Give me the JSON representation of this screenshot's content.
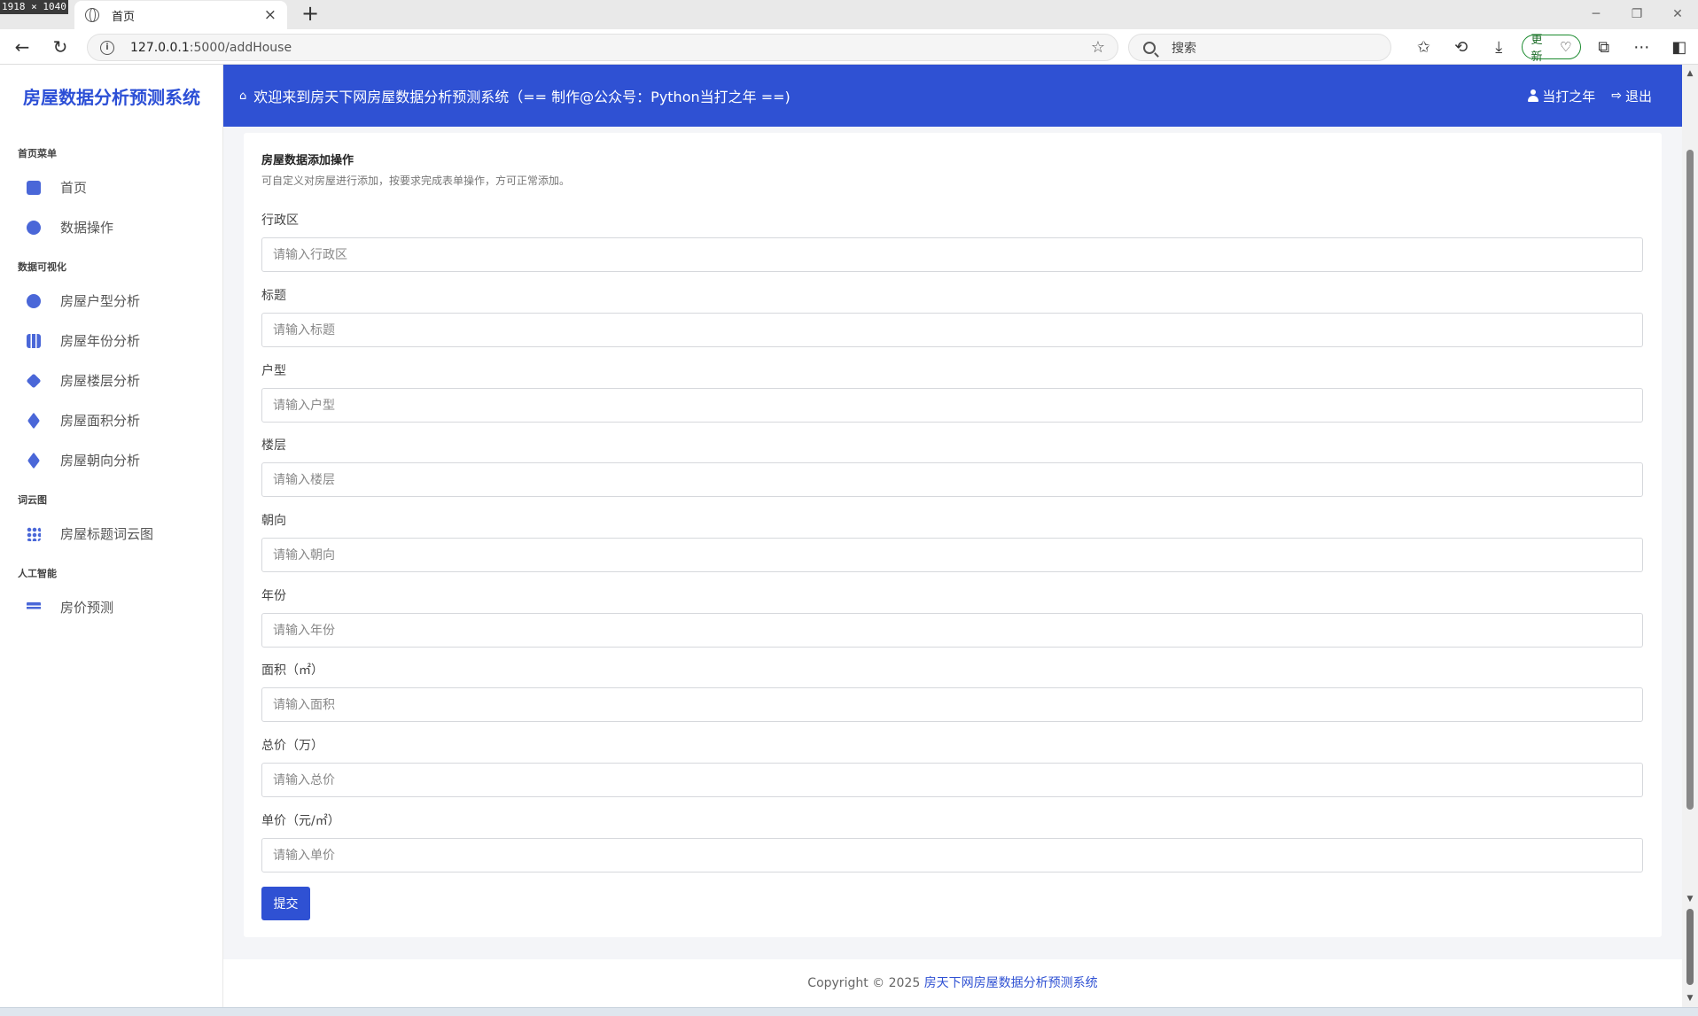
{
  "screen_badge": "1918 × 1040",
  "browser": {
    "tab_title": "首页",
    "url_host": "127.0.0.1",
    "url_rest": ":5000/addHouse",
    "search_placeholder": "搜索",
    "update_label": "更新"
  },
  "brand": "房屋数据分析预测系统",
  "sidebar": {
    "sections": [
      {
        "title": "首页菜单",
        "items": [
          {
            "label": "首页",
            "icon": "monitor-icon"
          },
          {
            "label": "数据操作",
            "icon": "chat-icon"
          }
        ]
      },
      {
        "title": "数据可视化",
        "items": [
          {
            "label": "房屋户型分析",
            "icon": "pie-icon"
          },
          {
            "label": "房屋年份分析",
            "icon": "columns-icon"
          },
          {
            "label": "房屋楼层分析",
            "icon": "cube-icon"
          },
          {
            "label": "房屋面积分析",
            "icon": "layers-icon"
          },
          {
            "label": "房屋朝向分析",
            "icon": "layers-icon"
          }
        ]
      },
      {
        "title": "词云图",
        "items": [
          {
            "label": "房屋标题词云图",
            "icon": "grid-icon"
          }
        ]
      },
      {
        "title": "人工智能",
        "items": [
          {
            "label": "房价预测",
            "icon": "list-icon"
          }
        ]
      }
    ]
  },
  "header": {
    "welcome": "欢迎来到房天下网房屋数据分析预测系统（== 制作@公众号：Python当打之年 ==)",
    "user": "当打之年",
    "logout": "退出"
  },
  "form": {
    "title": "房屋数据添加操作",
    "description": "可自定义对房屋进行添加，按要求完成表单操作，方可正常添加。",
    "fields": [
      {
        "label": "行政区",
        "placeholder": "请输入行政区"
      },
      {
        "label": "标题",
        "placeholder": "请输入标题"
      },
      {
        "label": "户型",
        "placeholder": "请输入户型"
      },
      {
        "label": "楼层",
        "placeholder": "请输入楼层"
      },
      {
        "label": "朝向",
        "placeholder": "请输入朝向"
      },
      {
        "label": "年份",
        "placeholder": "请输入年份"
      },
      {
        "label": "面积（㎡）",
        "placeholder": "请输入面积"
      },
      {
        "label": "总价（万）",
        "placeholder": "请输入总价"
      },
      {
        "label": "单价（元/㎡）",
        "placeholder": "请输入单价"
      }
    ],
    "submit": "提交"
  },
  "footer": {
    "prefix": "Copyright © 2025 ",
    "link": "房天下网房屋数据分析预测系统"
  },
  "colors": {
    "brand_blue": "#2f51d3",
    "update_green": "#1a8a2e"
  }
}
